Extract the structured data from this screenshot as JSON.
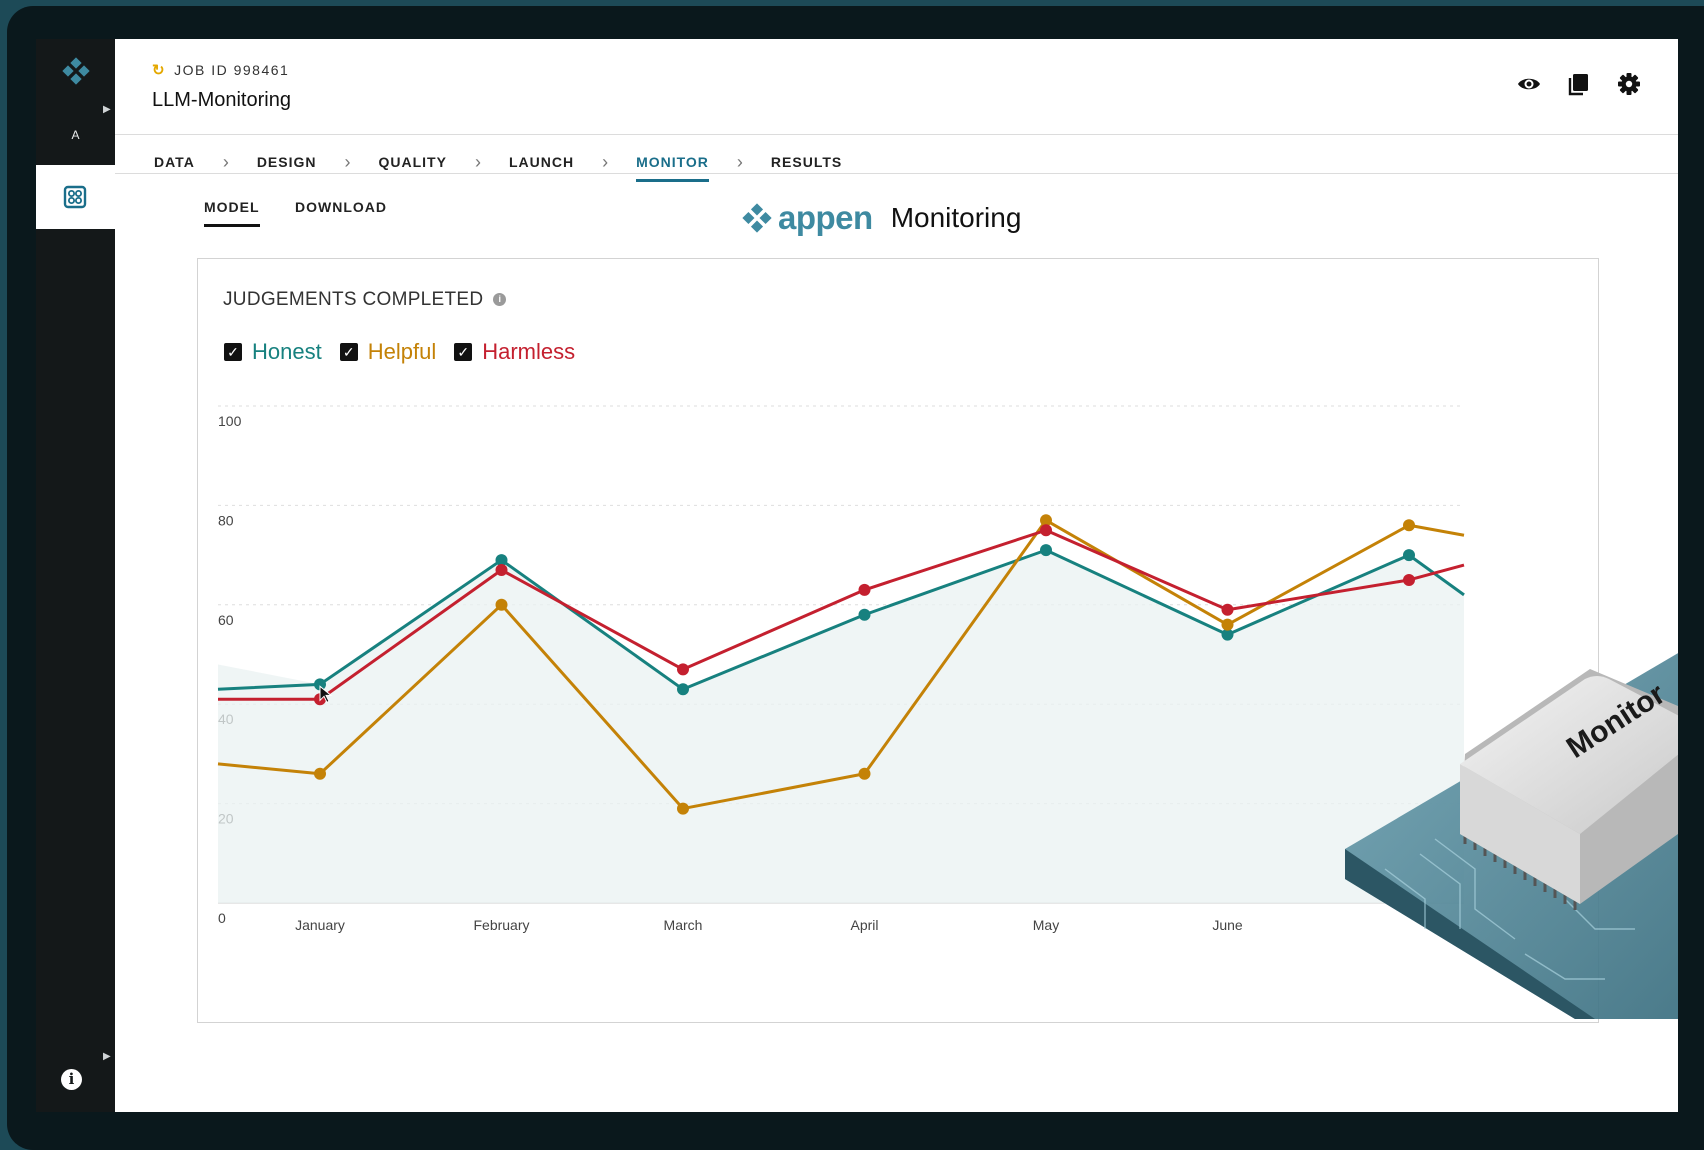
{
  "job": {
    "id_label": "JOB ID 998461",
    "title": "LLM-Monitoring"
  },
  "sidebar": {
    "letter": "A"
  },
  "steps": [
    "DATA",
    "DESIGN",
    "QUALITY",
    "LAUNCH",
    "MONITOR",
    "RESULTS"
  ],
  "active_step": "MONITOR",
  "subtabs": {
    "model": "MODEL",
    "download": "DOWNLOAD"
  },
  "brand": {
    "word": "appen",
    "product": "Monitoring"
  },
  "colors": {
    "honest": "#17817f",
    "helpful": "#c48207",
    "harmless": "#c4202f",
    "accent": "#1a6e8a"
  },
  "icons": {
    "header": [
      "eye-icon",
      "copy-icon",
      "gear-icon"
    ]
  },
  "chart_data": {
    "type": "line",
    "title": "JUDGEMENTS COMPLETED",
    "categories": [
      "January",
      "February",
      "March",
      "April",
      "May",
      "June"
    ],
    "ylim": [
      0,
      100
    ],
    "yticks": [
      "0",
      "20",
      "40",
      "60",
      "80",
      "100"
    ],
    "grid": true,
    "legend_position": "top-left",
    "series": [
      {
        "name": "Honest",
        "color": "#17817f",
        "values": [
          44,
          69,
          43,
          58,
          71,
          54,
          70
        ],
        "line_start": 43,
        "line_end": 62
      },
      {
        "name": "Helpful",
        "color": "#c48207",
        "values": [
          26,
          60,
          19,
          26,
          77,
          56,
          76
        ],
        "line_start": 28,
        "line_end": 74
      },
      {
        "name": "Harmless",
        "color": "#c4202f",
        "values": [
          41,
          67,
          47,
          63,
          75,
          59,
          65
        ],
        "line_start": 41,
        "line_end": 68
      }
    ]
  }
}
